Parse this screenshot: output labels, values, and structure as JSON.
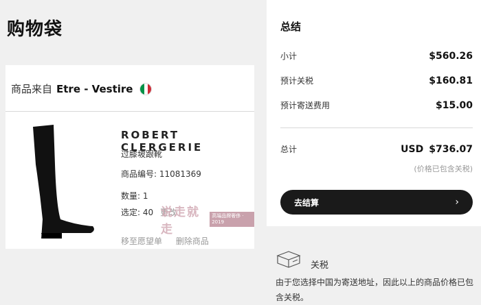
{
  "page": {
    "title": "购物袋"
  },
  "seller": {
    "prefix": "商品来自",
    "name": "Etre - Vestire"
  },
  "product": {
    "brand": "ROBERT CLERGERIE",
    "description": "过膝坡跟靴",
    "sku": "商品编号: 11081369",
    "quantity": "数量: 1",
    "size": "选定: 40",
    "change_label": "更改",
    "move_to_wishlist": "移至愿望单",
    "remove": "删除商品"
  },
  "summary": {
    "title": "总结",
    "subtotal_label": "小计",
    "subtotal_value": "$560.26",
    "tax_label": "预计关税",
    "tax_value": "$160.81",
    "shipping_label": "预计寄送费用",
    "shipping_value": "$15.00",
    "total_label": "总计",
    "total_currency": "USD",
    "total_value": "$736.07",
    "tax_note": "(价格已包含关税)",
    "checkout_label": "去结算"
  },
  "duties": {
    "title": "关税",
    "text": "由于您选择中国为寄送地址，因此以上的商品价格已包含关税。"
  },
  "watermark": {
    "main": "说走就走",
    "box": "高端品牌奢侈 · 2019"
  },
  "colors": {
    "italy_green": "#009246",
    "italy_white": "#ffffff",
    "italy_red": "#ce2b37"
  }
}
